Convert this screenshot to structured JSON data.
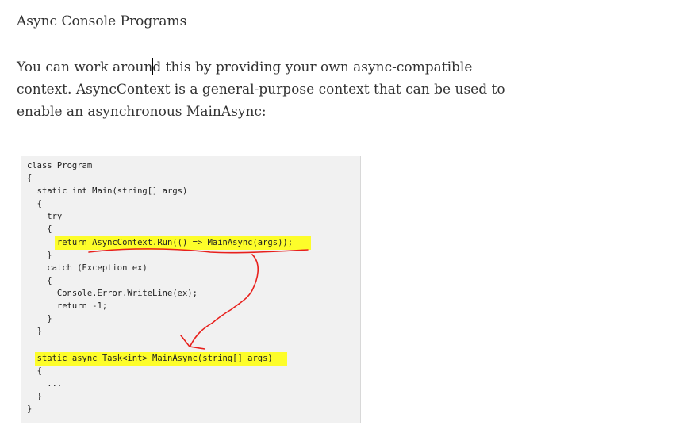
{
  "heading": "Async Console Programs",
  "paragraph": {
    "lines": [
      "You can work around this by providing your own async-compatible",
      "context. AsyncContext is a general-purpose context that can be used to",
      "enable an asynchronous MainAsync:"
    ]
  },
  "code": {
    "lines": [
      "class Program",
      "{",
      "  static int Main(string[] args)",
      "  {",
      "    try",
      "    {",
      "      return AsyncContext.Run(() => MainAsync(args));",
      "    }",
      "    catch (Exception ex)",
      "    {",
      "      Console.Error.WriteLine(ex);",
      "      return -1;",
      "    }",
      "  }",
      "",
      "  static async Task<int> MainAsync(string[] args)",
      "  {",
      "    ...",
      "  }",
      "}"
    ],
    "highlighted_lines": [
      "return AsyncContext.Run(() => MainAsync(args));",
      "static async Task<int> MainAsync(string[] args)"
    ],
    "highlight_color": "#fdfd2a"
  },
  "annotation": {
    "color": "#e8201c",
    "shapes": [
      "underline",
      "arrow"
    ]
  }
}
